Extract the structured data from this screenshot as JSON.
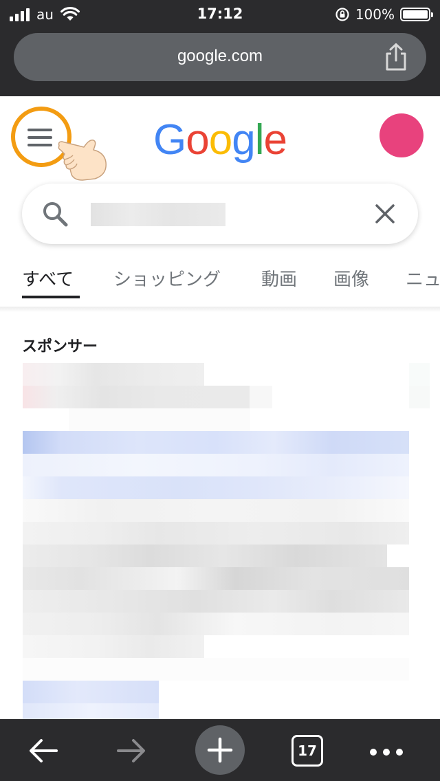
{
  "status_bar": {
    "carrier": "au",
    "time": "17:12",
    "battery": "100%"
  },
  "browser": {
    "url": "google.com",
    "open_tabs": "17"
  },
  "google": {
    "logo_letters": [
      "G",
      "o",
      "o",
      "g",
      "l",
      "e"
    ],
    "logo_colors": [
      "#4285F4",
      "#EA4335",
      "#FBBC05",
      "#4285F4",
      "#34A853",
      "#EA4335"
    ],
    "avatar_color": "#e8427d",
    "highlight_ring_color": "#f39c12"
  },
  "search": {
    "query_redacted": true
  },
  "tabs": [
    {
      "label": "すべて",
      "active": true
    },
    {
      "label": "ショッピング",
      "active": false
    },
    {
      "label": "動画",
      "active": false
    },
    {
      "label": "画像",
      "active": false
    },
    {
      "label": "ニュ",
      "active": false
    }
  ],
  "results": {
    "sponsor_label": "スポンサー"
  },
  "icons": {
    "menu": "hamburger-menu-icon",
    "pointer": "pointing-hand-icon",
    "share": "share-icon",
    "search": "search-icon",
    "clear": "close-icon",
    "back": "back-arrow-icon",
    "forward": "forward-arrow-icon",
    "new_tab": "plus-icon",
    "more": "more-dots-icon"
  }
}
